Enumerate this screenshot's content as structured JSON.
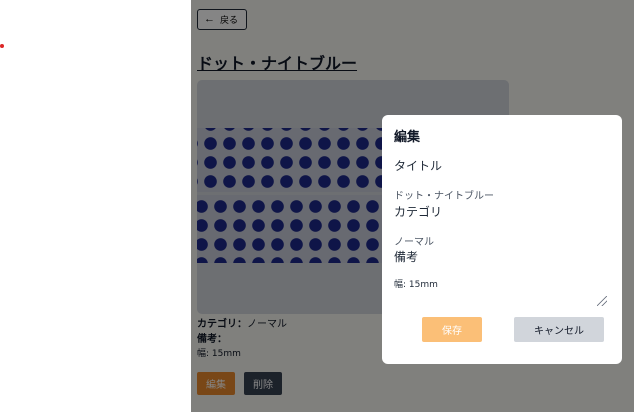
{
  "nav": {
    "back_label": "戻る"
  },
  "product": {
    "title": "ドット・ナイトブルー",
    "category_label": "カテゴリ：",
    "category_value": "ノーマル",
    "note_label": "備考：",
    "note_value": "幅: 15mm"
  },
  "actions": {
    "edit_label": "編集",
    "delete_label": "削除"
  },
  "modal": {
    "title": "編集",
    "title_field_label": "タイトル",
    "title_field_value": "ドット・ナイトブルー",
    "category_field_label": "カテゴリ",
    "category_field_value": "ノーマル",
    "note_field_label": "備考",
    "note_field_value": "幅: 15mm",
    "save_label": "保存",
    "cancel_label": "キャンセル"
  },
  "colors": {
    "edit_button": "#e8892c",
    "delete_button": "#374151",
    "save_button": "#fbbf77",
    "cancel_button": "#d1d5db",
    "dot_color": "#1e2a8a",
    "indicator_dot": "#dc2626"
  },
  "icons": {
    "back": "arrow-left-icon",
    "resize": "resize-grip-icon"
  }
}
